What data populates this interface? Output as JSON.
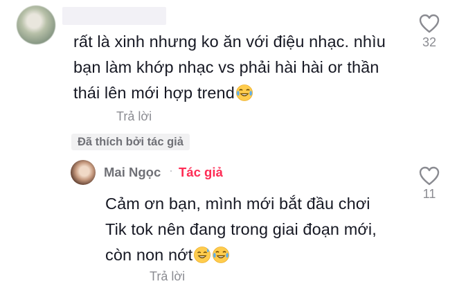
{
  "main_comment": {
    "text_lines": [
      "rất là xinh nhưng ko ăn với điệu nhạc. nhìu",
      "bạn làm khớp nhạc vs phải hài hài or thần",
      "thái lên mới hợp trend"
    ],
    "emojis": [
      "tears-of-joy-emoji"
    ],
    "reply_label": "Trả lời",
    "like_count": "32",
    "badge": "Đã thích bởi tác giả"
  },
  "reply": {
    "username": "Mai Ngọc",
    "separator": "·",
    "author_label": "Tác giả",
    "text_lines": [
      "Cảm ơn bạn, mình mới bắt đầu chơi",
      "Tik tok nên đang trong giai đoạn mới,",
      "còn non nớt"
    ],
    "emojis": [
      "sweat-smile-emoji",
      "tears-of-joy-emoji"
    ],
    "reply_label": "Trả lời",
    "like_count": "11"
  },
  "colors": {
    "text": "#161823",
    "secondary": "#8a8b91",
    "author_accent": "#fe2c55",
    "badge_bg": "#f1f1f2"
  }
}
